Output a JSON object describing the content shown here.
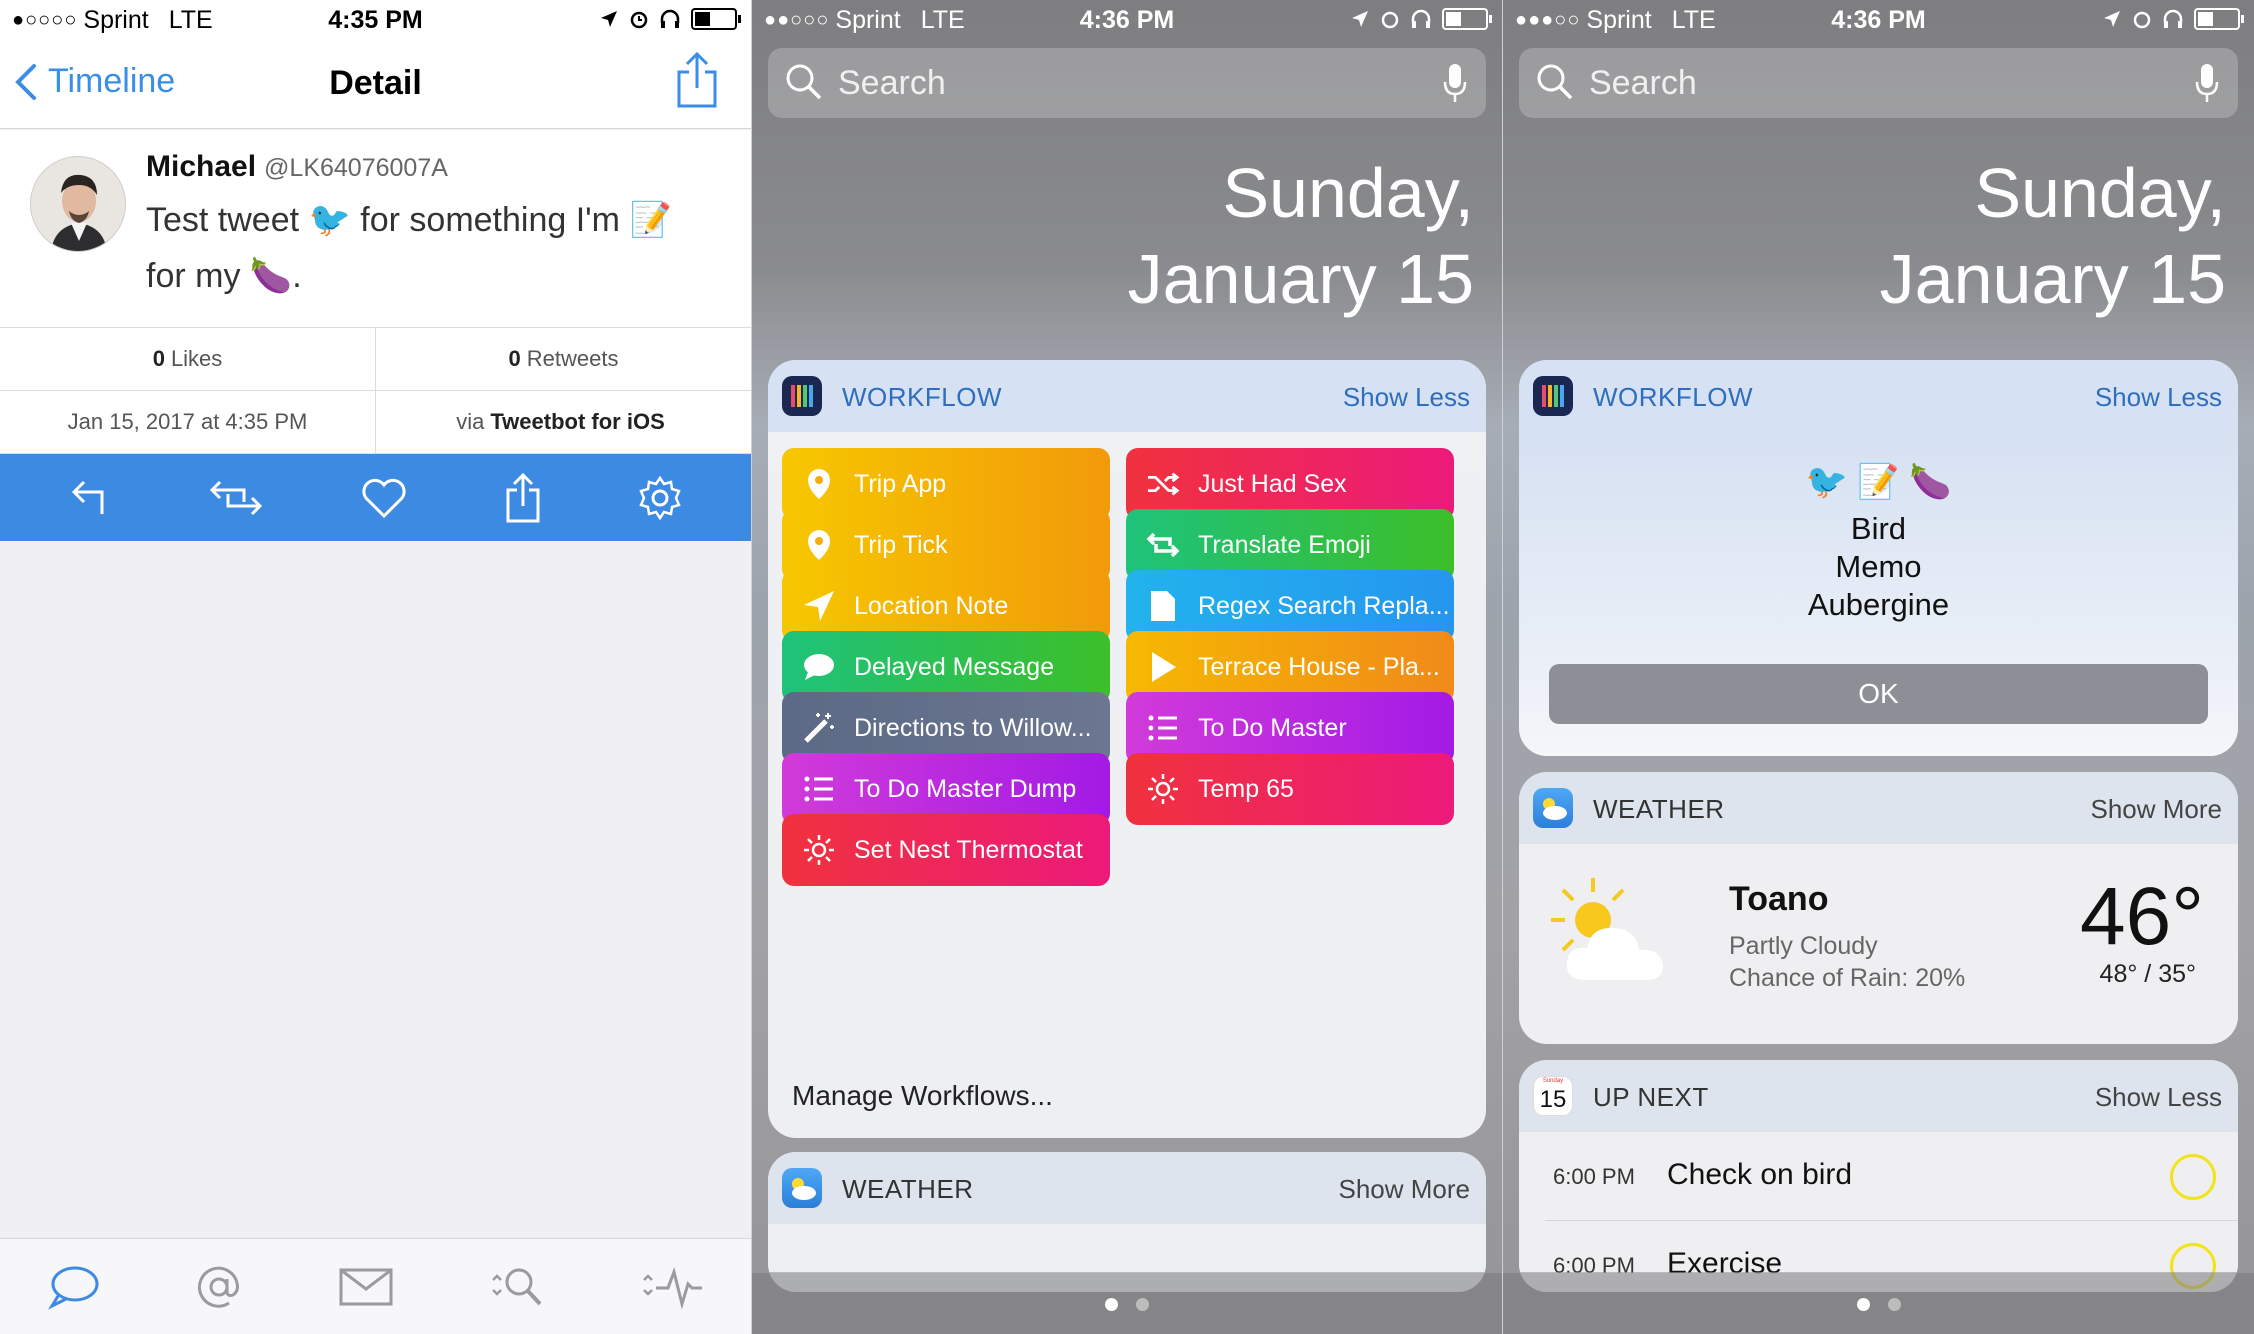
{
  "tweetbot": {
    "status": {
      "carrier": "Sprint",
      "network": "LTE",
      "time": "4:35 PM",
      "signal": "●○○○○"
    },
    "nav": {
      "back_label": "Timeline",
      "title": "Detail"
    },
    "tweet": {
      "name": "Michael",
      "handle": "@LK64076007A",
      "text_line1": "Test tweet 🐦 for something I'm 📝",
      "text_line2": "for my 🍆."
    },
    "stats": {
      "likes_count": "0",
      "likes_label": "Likes",
      "retweets_count": "0",
      "retweets_label": "Retweets",
      "date": "Jan 15, 2017 at 4:35 PM",
      "via_prefix": "via",
      "via_client": "Tweetbot for iOS"
    },
    "colors": {
      "accent": "#3d8ae3"
    }
  },
  "widgets1": {
    "status": {
      "carrier": "Sprint",
      "network": "LTE",
      "time": "4:36 PM",
      "signal": "●●○○○"
    },
    "search_placeholder": "Search",
    "date_line1": "Sunday,",
    "date_line2": "January 15",
    "workflow": {
      "title": "WORKFLOW",
      "toggle": "Show Less",
      "buttons": [
        {
          "label": "Trip App",
          "icon": "pin-icon"
        },
        {
          "label": "Just Had Sex",
          "icon": "shuffle-icon"
        },
        {
          "label": "Trip Tick",
          "icon": "pin-icon"
        },
        {
          "label": "Translate Emoji",
          "icon": "repeat-icon"
        },
        {
          "label": "Location Note",
          "icon": "location-arrow-icon"
        },
        {
          "label": "Regex Search Repla...",
          "icon": "document-icon"
        },
        {
          "label": "Delayed Message",
          "icon": "speech-bubble-icon"
        },
        {
          "label": "Terrace House - Pla...",
          "icon": "play-icon"
        },
        {
          "label": "Directions to Willow...",
          "icon": "magic-wand-icon"
        },
        {
          "label": "To Do Master",
          "icon": "list-icon"
        },
        {
          "label": "To Do Master Dump",
          "icon": "list-icon"
        },
        {
          "label": "Temp 65",
          "icon": "sun-icon"
        },
        {
          "label": "Set Nest Thermostat",
          "icon": "sun-icon"
        }
      ],
      "manage": "Manage Workflows..."
    },
    "weather": {
      "title": "WEATHER",
      "toggle": "Show More"
    }
  },
  "widgets2": {
    "status": {
      "carrier": "Sprint",
      "network": "LTE",
      "time": "4:36 PM",
      "signal": "●●●○○"
    },
    "search_placeholder": "Search",
    "date_line1": "Sunday,",
    "date_line2": "January 15",
    "workflow": {
      "title": "WORKFLOW",
      "toggle": "Show Less",
      "emoji": "🐦  📝  🍆",
      "result_lines": [
        "Bird",
        "Memo",
        "Aubergine"
      ],
      "ok_label": "OK"
    },
    "weather": {
      "title": "WEATHER",
      "toggle": "Show More",
      "location": "Toano",
      "condition": "Partly Cloudy",
      "rain": "Chance of Rain: 20%",
      "temp": "46°",
      "hilo": "48° / 35°"
    },
    "upnext": {
      "title": "UP NEXT",
      "toggle": "Show Less",
      "icon_day": "15",
      "icon_weekday": "Sunday",
      "events": [
        {
          "time": "6:00 PM",
          "title": "Check on bird"
        },
        {
          "time": "6:00 PM",
          "title": "Exercise"
        }
      ]
    }
  }
}
